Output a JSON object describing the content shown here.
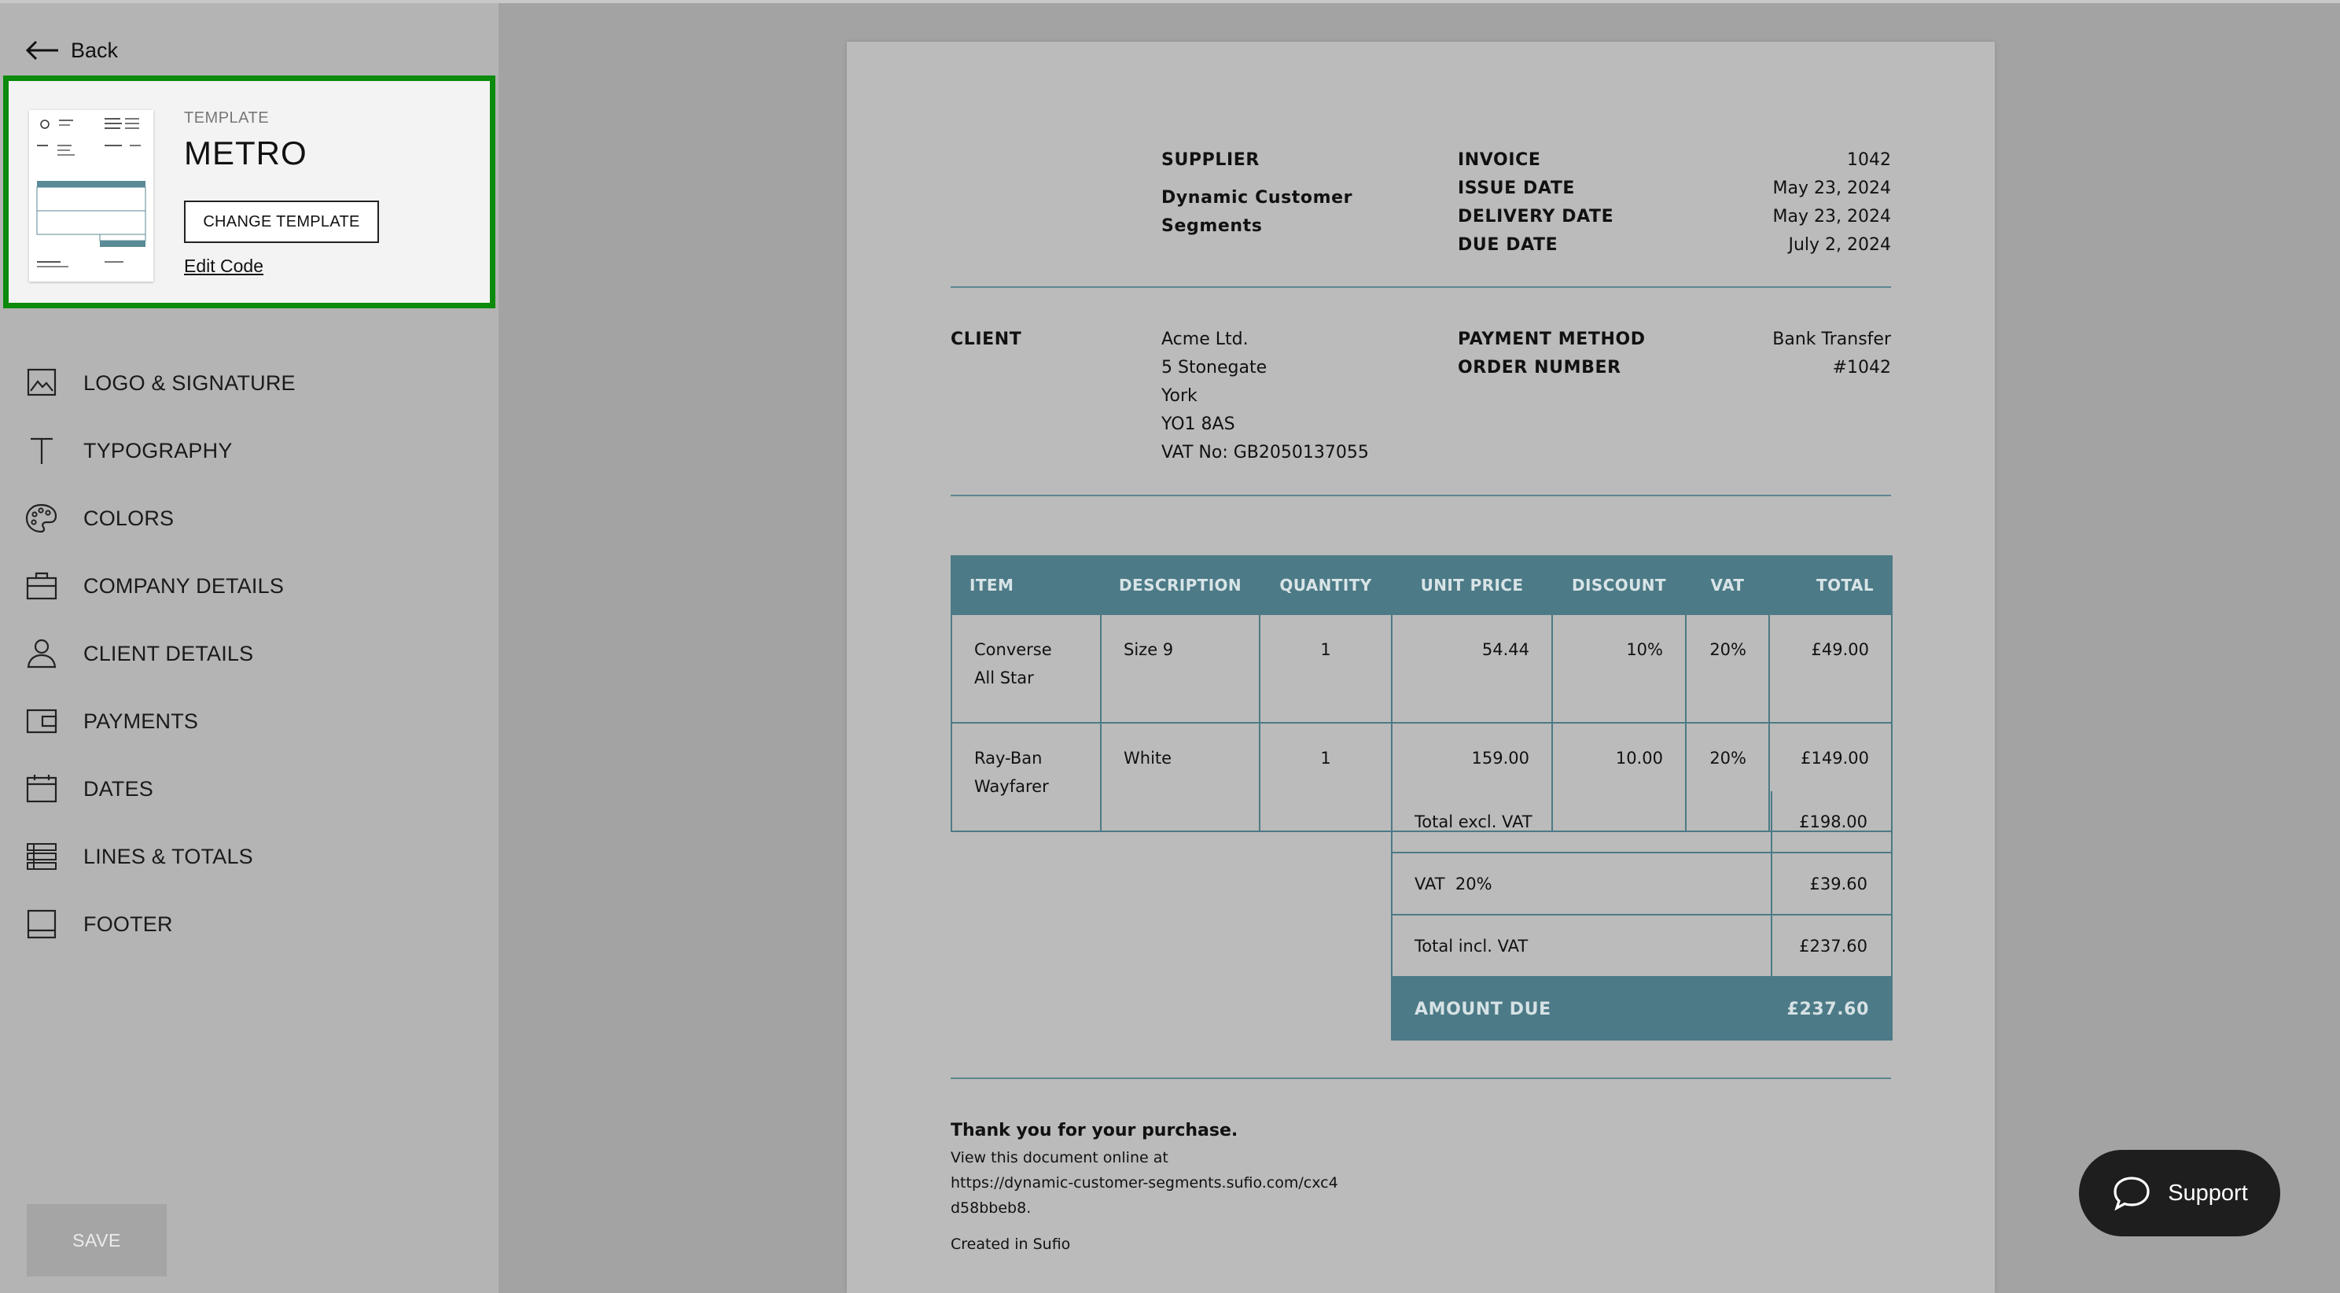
{
  "sidebar": {
    "back_label": "Back",
    "template": {
      "caption": "TEMPLATE",
      "name": "METRO",
      "change_label": "CHANGE TEMPLATE",
      "edit_label": "Edit Code"
    },
    "menu": [
      {
        "label": "LOGO & SIGNATURE",
        "icon": "image-icon"
      },
      {
        "label": "TYPOGRAPHY",
        "icon": "text-icon"
      },
      {
        "label": "COLORS",
        "icon": "palette-icon"
      },
      {
        "label": "COMPANY DETAILS",
        "icon": "briefcase-icon"
      },
      {
        "label": "CLIENT DETAILS",
        "icon": "person-icon"
      },
      {
        "label": "PAYMENTS",
        "icon": "wallet-icon"
      },
      {
        "label": "DATES",
        "icon": "calendar-icon"
      },
      {
        "label": "LINES & TOTALS",
        "icon": "list-icon"
      },
      {
        "label": "FOOTER",
        "icon": "footer-icon"
      }
    ],
    "save_label": "SAVE"
  },
  "invoice": {
    "supplier_label": "SUPPLIER",
    "supplier_name_1": "Dynamic Customer",
    "supplier_name_2": "Segments",
    "meta": [
      {
        "label": "INVOICE",
        "value": "1042"
      },
      {
        "label": "ISSUE DATE",
        "value": "May 23, 2024"
      },
      {
        "label": "DELIVERY DATE",
        "value": "May 23, 2024"
      },
      {
        "label": "DUE DATE",
        "value": "July 2, 2024"
      }
    ],
    "client_label": "CLIENT",
    "client_lines": [
      "Acme Ltd.",
      "5 Stonegate",
      "York",
      "YO1 8AS",
      "VAT No: GB2050137055"
    ],
    "payment": [
      {
        "label": "PAYMENT METHOD",
        "value": "Bank Transfer"
      },
      {
        "label": "ORDER NUMBER",
        "value": "#1042"
      }
    ],
    "columns": [
      "ITEM",
      "DESCRIPTION",
      "QUANTITY",
      "UNIT PRICE",
      "DISCOUNT",
      "VAT",
      "TOTAL"
    ],
    "rows": [
      {
        "item_1": "Converse",
        "item_2": "All Star",
        "description": "Size 9",
        "quantity": "1",
        "unit_price": "54.44",
        "discount": "10%",
        "vat": "20%",
        "total": "£49.00"
      },
      {
        "item_1": "Ray-Ban",
        "item_2": "Wayfarer",
        "description": "White",
        "quantity": "1",
        "unit_price": "159.00",
        "discount": "10.00",
        "vat": "20%",
        "total": "£149.00"
      }
    ],
    "totals": [
      {
        "label": "Total excl. VAT",
        "value": "£198.00"
      },
      {
        "label": "VAT  20%",
        "value": "£39.60"
      },
      {
        "label": "Total incl. VAT",
        "value": "£237.60"
      }
    ],
    "amount_due_label": "AMOUNT DUE",
    "amount_due_value": "£237.60",
    "footer": {
      "thanks": "Thank you for your purchase.",
      "line1": "View this document online at",
      "line2": "https://dynamic-customer-segments.sufio.com/cxc4",
      "line3": "d58bbeb8.",
      "created": "Created in Sufio"
    }
  },
  "support_label": "Support",
  "colors": {
    "accent": "#4c7a86",
    "highlight_border": "#0b8a0b"
  }
}
